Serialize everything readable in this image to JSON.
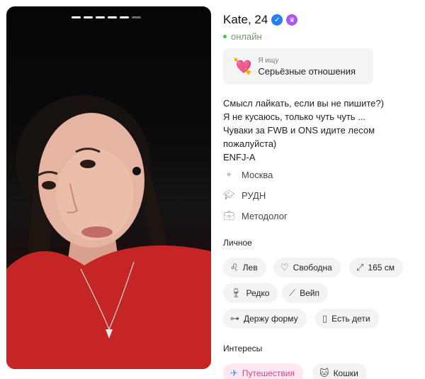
{
  "profile": {
    "name_age": "Kate, 24",
    "status": "онлайн",
    "seeking": {
      "label": "Я ищу",
      "value": "Серьёзные отношения"
    },
    "bio_lines": [
      "Смысл лайкать, если вы не пишите?)",
      "Я не кусаюсь, только чуть чуть ...",
      "Чуваки за FWB и ONS идите лесом",
      "пожалуйста)",
      "ENFJ-A"
    ],
    "city": "Москва",
    "university": "РУДН",
    "job": "Методолог"
  },
  "photo": {
    "count": 6,
    "active_index": 5
  },
  "personal": {
    "title": "Личное",
    "chips": [
      {
        "label": "Лев",
        "icon": "leo-icon"
      },
      {
        "label": "Свободна",
        "icon": "heart-icon"
      },
      {
        "label": "165 см",
        "icon": "height-icon"
      },
      {
        "label": "Редко",
        "icon": "wine-glass-icon"
      },
      {
        "label": "Вейп",
        "icon": "vape-icon"
      },
      {
        "label": "Держу форму",
        "icon": "dumbbell-icon"
      },
      {
        "label": "Есть дети",
        "icon": "bottle-icon"
      }
    ]
  },
  "interests": {
    "title": "Интересы",
    "chips": [
      {
        "label": "Путешествия",
        "icon": "airplane-icon"
      },
      {
        "label": "Кошки",
        "icon": "cat-icon"
      }
    ]
  },
  "colors": {
    "verified": "#2b7ff5",
    "crown": "#a758f0",
    "online": "#4cc14c",
    "accent_chip": "#fde7f1"
  }
}
